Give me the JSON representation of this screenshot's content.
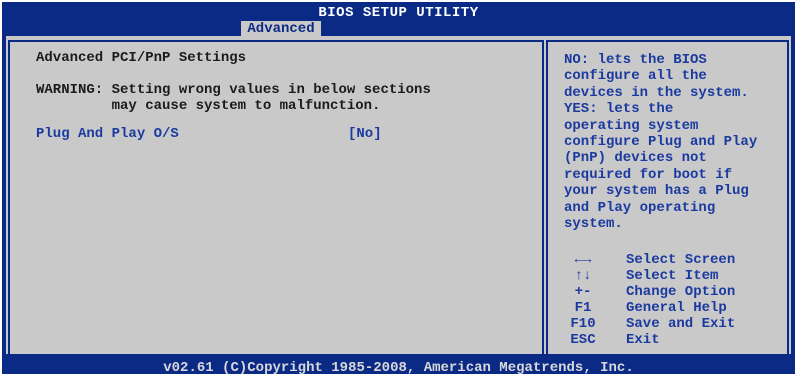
{
  "header": {
    "title": "BIOS SETUP UTILITY",
    "active_tab": "Advanced"
  },
  "main": {
    "section_title": "Advanced PCI/PnP Settings",
    "warning": "WARNING: Setting wrong values in below sections\n         may cause system to malfunction.",
    "settings": [
      {
        "label": "Plug And Play O/S",
        "value": "[No]"
      }
    ]
  },
  "help": {
    "text": "NO: lets the BIOS\nconfigure all the\ndevices in the system.\nYES: lets the\noperating system\nconfigure Plug and Play\n(PnP) devices not\nrequired for boot if\nyour system has a Plug\nand Play operating\nsystem.",
    "keys": [
      {
        "key": "←→",
        "desc": "Select Screen"
      },
      {
        "key": "↑↓",
        "desc": "Select Item"
      },
      {
        "key": "+-",
        "desc": "Change Option"
      },
      {
        "key": "F1",
        "desc": "General Help"
      },
      {
        "key": "F10",
        "desc": "Save and Exit"
      },
      {
        "key": "ESC",
        "desc": "Exit"
      }
    ]
  },
  "footer": {
    "copyright": "v02.61 (C)Copyright 1985-2008, American Megatrends, Inc."
  },
  "colors": {
    "background": "#0a2a86",
    "panel": "#c9c9c9",
    "highlight_text": "#1a3aa0",
    "text": "#1b1b1b"
  }
}
